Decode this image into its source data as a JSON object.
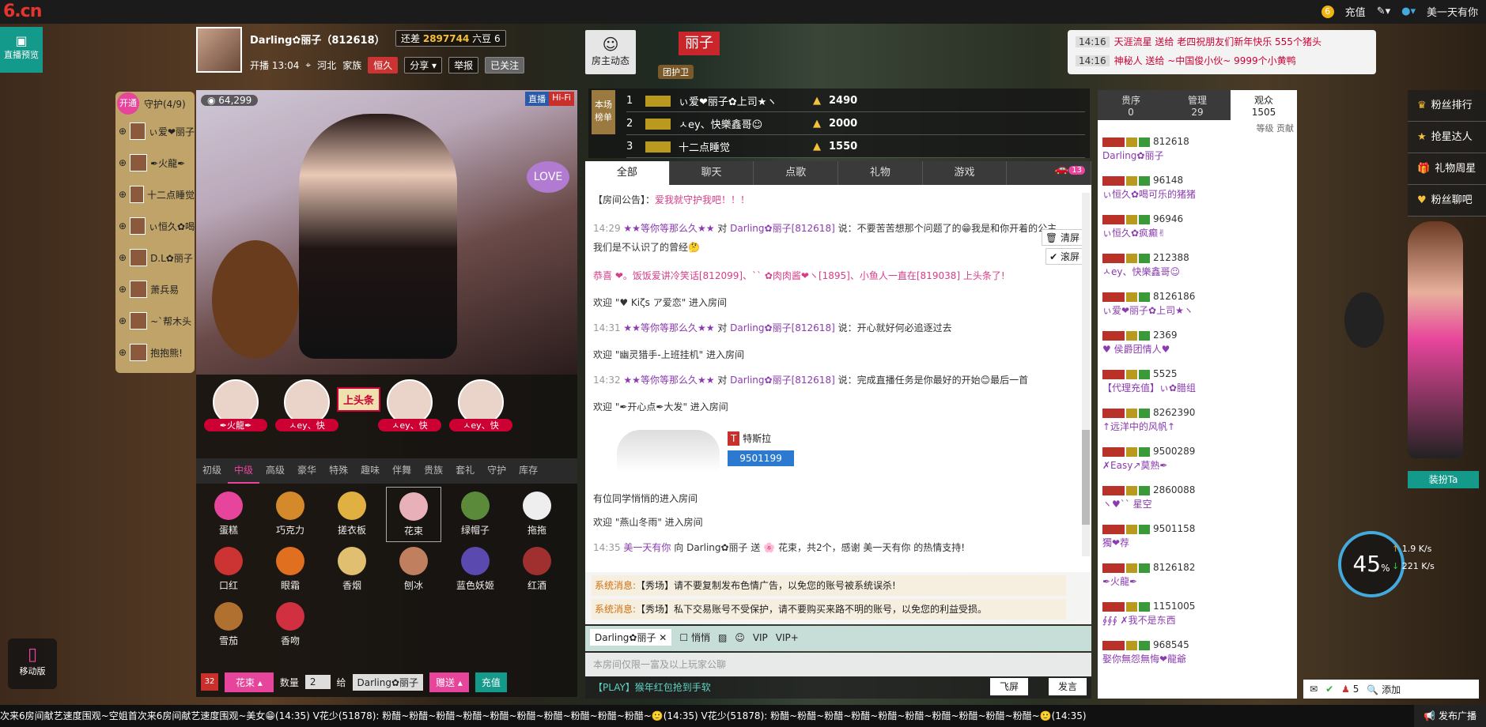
{
  "topbar": {
    "logo": "6.cn",
    "recharge": "充值",
    "user": "美一天有你"
  },
  "left": {
    "preview": "直播预览",
    "mobile": "移动版"
  },
  "host": {
    "name": "Darling✿丽子（812618）",
    "time": "开播 13:04",
    "location": "河北",
    "family": "家族",
    "family_badge": "恒久",
    "beans_label": "还差",
    "beans": "2897744",
    "beans_suffix": "六豆 6",
    "share": "分享",
    "report": "举报",
    "followed": "已关注",
    "owner_dynamic": "房主动态",
    "badge_name": "丽子",
    "guard_label": "团护卫"
  },
  "guard": {
    "open": "开通",
    "title": "守护(4/9)",
    "items": [
      "ぃ爱❤丽子",
      "✒火龍✒",
      "十二点睡觉",
      "ぃ恒久✿喝",
      "D.L✿丽子",
      "萧兵易",
      "~`帮木头",
      "抱抱熊!"
    ]
  },
  "video": {
    "viewers": "64,299",
    "live": "直播",
    "quality": "Hi-Fi"
  },
  "seats": [
    "✒火龍✒",
    "ㅅey、快",
    "ㅅey、快",
    "ㅅey、快"
  ],
  "headline": "上头条",
  "gifttabs": [
    "初级",
    "中级",
    "高级",
    "豪华",
    "特殊",
    "趣味",
    "伴舞",
    "贵族",
    "套礼",
    "守护",
    "库存"
  ],
  "gifts": [
    "蛋糕",
    "巧克力",
    "搓衣板",
    "花束",
    "绿帽子",
    "拖拖",
    "口红",
    "眼霜",
    "香烟",
    "刨冰",
    "蓝色妖姬",
    "红酒",
    "雪茄",
    "香吻"
  ],
  "giftbar": {
    "count_badge": "32",
    "selected_gift": "花束",
    "qty_label": "数量",
    "qty": "2",
    "give": "给",
    "target": "Darling✿丽子",
    "send": "赠送",
    "recharge": "充值"
  },
  "rank": {
    "label": "本场榜单",
    "rows": [
      {
        "n": "1",
        "name": "ぃ爱❤丽子✿上司★ヽ",
        "score": "2490"
      },
      {
        "n": "2",
        "name": "ㅅey、快樂鑫哥☺",
        "score": "2000"
      },
      {
        "n": "3",
        "name": "十二点睡觉",
        "score": "1550"
      }
    ]
  },
  "chattabs": [
    "全部",
    "聊天",
    "点歌",
    "礼物",
    "游戏"
  ],
  "car_count": "13",
  "chat": {
    "announce_label": "【房间公告】：",
    "announce": "爱我就守护我吧！！！",
    "m1_time": "14:29",
    "m1_from": "★★等你等那么久★★",
    "m1_to": "Darling✿丽子[812618]",
    "m1_text": "说：不要苦苦想那个问题了的😁我是和你开着的公主",
    "m1b": "我们是不认识了的曾经🤔",
    "m2": "恭喜 ❤。饭饭爱讲冷笑话[812099]、`` ✿肉肉酱❤ヽ[1895]、小鱼人一直在[819038] 上头条了!",
    "m3": "欢迎 \"♥ Kiζs ア爱恋\" 进入房间",
    "m4_time": "14:31",
    "m4_from": "★★等你等那么久★★",
    "m4_to": "Darling✿丽子[812618]",
    "m4_text": "说：开心就好何必追逐过去",
    "m5": "欢迎 \"幽灵猎手-上班挂机\" 进入房间",
    "m6_time": "14:32",
    "m6_from": "★★等你等那么久★★",
    "m6_to": "Darling✿丽子[812618]",
    "m6_text": "说：完成直播任务是你最好的开始😊最后一首",
    "m7": "欢迎 \"✒开心点✒大发\" 进入房间",
    "car_brand": "特斯拉",
    "car_id": "9501199",
    "m8": "有位同学悄悄的进入房间",
    "m9": "欢迎 \"燕山冬雨\" 进入房间",
    "m10_time": "14:35",
    "m10_from": "美一天有你",
    "m10_mid": "向 Darling✿丽子 送",
    "m10_text": "花束，共2个，感谢 美一天有你 的热情支持!",
    "clear": "清屏",
    "scroll": "滚屏"
  },
  "sys": [
    {
      "label": "系统消息:",
      "text": "【秀场】请不要复制发布色情广告，以免您的账号被系统误杀!"
    },
    {
      "label": "系统消息:",
      "text": "【秀场】私下交易账号不受保护，请不要购买来路不明的账号，以免您的利益受损。"
    }
  ],
  "input": {
    "target": "Darling✿丽子",
    "whisper": "悄悄",
    "placeholder": "本房间仅限一富及以上玩家公聊",
    "fly": "飞屏",
    "send": "发言",
    "tip": "【PLAY】猴年红包抢到手软"
  },
  "aud_tabs": [
    {
      "label": "贵序",
      "count": "0"
    },
    {
      "label": "管理",
      "count": "29"
    },
    {
      "label": "观众",
      "count": "1505"
    }
  ],
  "aud_contrib": "贡献",
  "audience": [
    {
      "id": "812618",
      "name": "Darling✿丽子"
    },
    {
      "id": "96148",
      "name": "ぃ恒久✿喝可乐的猪猪"
    },
    {
      "id": "96946",
      "name": "ぃ恒久✿疯癫✌"
    },
    {
      "id": "212388",
      "name": "ㅅey、快樂鑫哥☺"
    },
    {
      "id": "8126186",
      "name": "ぃ爱❤丽子✿上司★ヽ"
    },
    {
      "id": "2369",
      "name": "♥ 侯爵团情人♥"
    },
    {
      "id": "5525",
      "name": "【代理充值】ぃ✿腊组"
    },
    {
      "id": "8262390",
      "name": "↑远洋中的风帆↑"
    },
    {
      "id": "9500289",
      "name": "✗Easy↗莫熟✒"
    },
    {
      "id": "2860088",
      "name": "ヽ♥`` 星空"
    },
    {
      "id": "9501158",
      "name": "獨❤荐"
    },
    {
      "id": "8126182",
      "name": "✒火龍✒"
    },
    {
      "id": "1151005",
      "name": "∮∮∮ ✗我不是东西"
    },
    {
      "id": "968545",
      "name": "娶你無怨無悔❤龍爺"
    }
  ],
  "rmenu": [
    "粉丝排行",
    "抢星达人",
    "礼物周星",
    "粉丝聊吧"
  ],
  "dress": "装扮Ta",
  "notices": [
    {
      "time": "14:16",
      "text": "天涯流星 送给 老四祝朋友们新年快乐 555个猪头"
    },
    {
      "time": "14:16",
      "text": "神秘人 送给 ~中国俊小伙~ 9999个小黄鸭"
    }
  ],
  "speed": {
    "percent": "45",
    "unit": "%",
    "up": "1.9",
    "down": "221",
    "rate": "K/s"
  },
  "bottom_right": {
    "count": "5",
    "add": "添加",
    "broadcast": "发布广播"
  },
  "ticker": "次来6房间献艺速度围观~空姐首次来6房间献艺速度围观~美女😁(14:35)   V花少(51878): 粉醋~粉醋~粉醋~粉醋~粉醋~粉醋~粉醋~粉醋~粉醋~粉醋~🙂(14:35)   V花少(51878): 粉醋~粉醋~粉醋~粉醋~粉醋~粉醋~粉醋~粉醋~粉醋~粉醋~🙂(14:35)"
}
